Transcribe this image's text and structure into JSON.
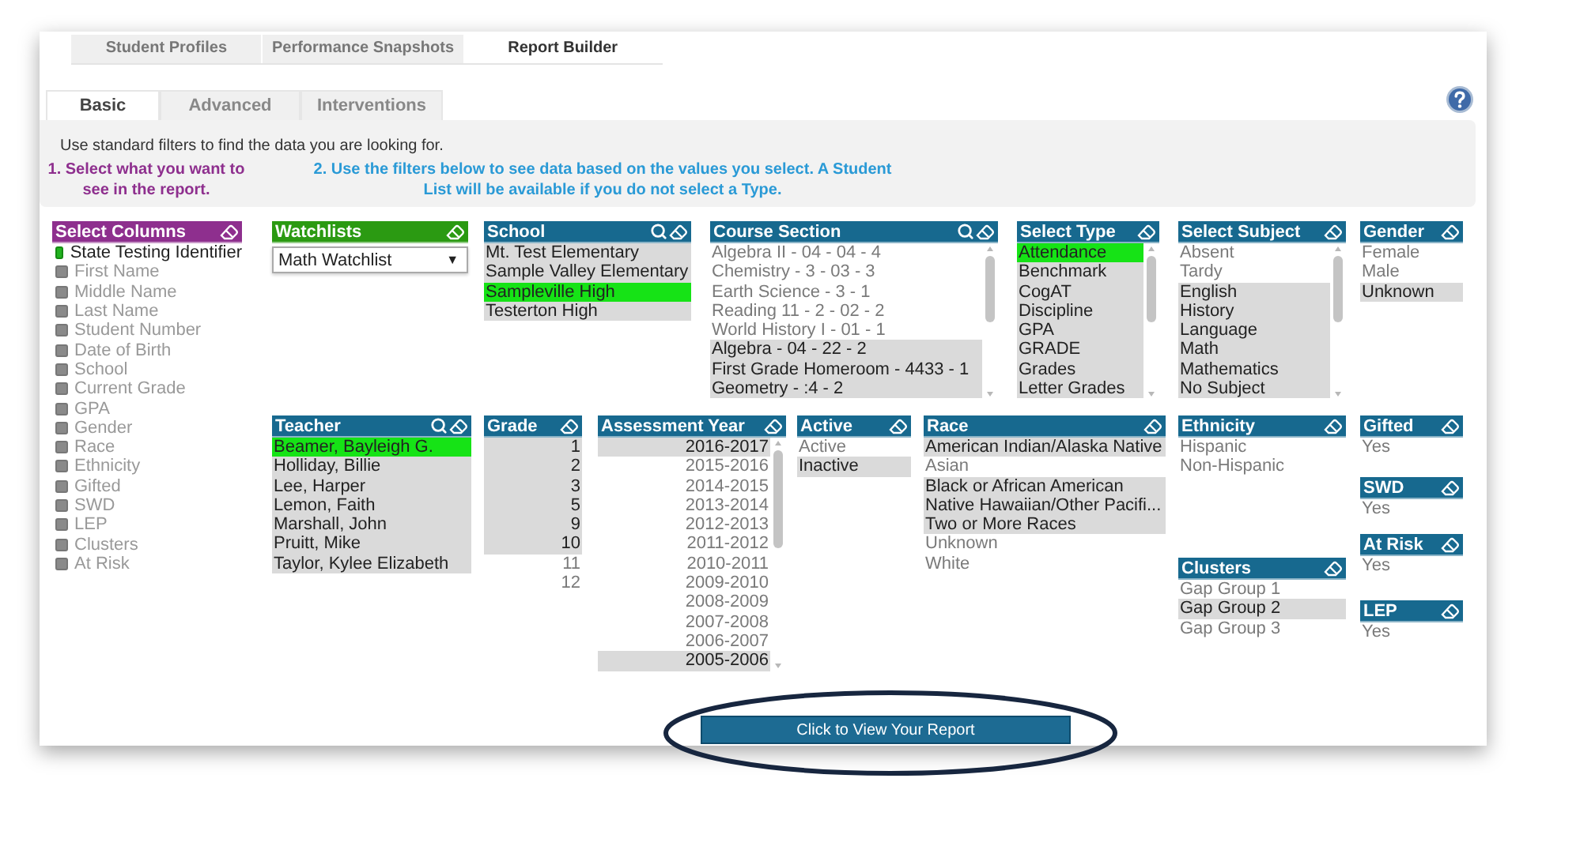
{
  "top_tabs": [
    {
      "label": "Student Profiles",
      "selected": false
    },
    {
      "label": "Performance Snapshots",
      "selected": false
    },
    {
      "label": "Report Builder",
      "selected": true
    }
  ],
  "sub_tabs": [
    {
      "label": "Basic",
      "selected": true
    },
    {
      "label": "Advanced",
      "selected": false
    },
    {
      "label": "Interventions",
      "selected": false
    }
  ],
  "intro": "Use standard filters to find the data you are looking for.",
  "steps": [
    {
      "text": "1. Select what you want to see in the report.",
      "color": "#8e2f8e"
    },
    {
      "text": "2. Use the filters below to see data based on the values you select. A Student List will be available if you do not select a Type.",
      "color": "#2a9ad6"
    }
  ],
  "columns_panel": {
    "title": "Select Columns",
    "color": "#8e2f8e",
    "items": [
      {
        "label": "State Testing Identifier",
        "checked": true
      },
      {
        "label": "First Name",
        "checked": false
      },
      {
        "label": "Middle Name",
        "checked": false
      },
      {
        "label": "Last Name",
        "checked": false
      },
      {
        "label": "Student Number",
        "checked": false
      },
      {
        "label": "Date of Birth",
        "checked": false
      },
      {
        "label": "School",
        "checked": false
      },
      {
        "label": "Current Grade",
        "checked": false
      },
      {
        "label": "GPA",
        "checked": false
      },
      {
        "label": "Gender",
        "checked": false
      },
      {
        "label": "Race",
        "checked": false
      },
      {
        "label": "Ethnicity",
        "checked": false
      },
      {
        "label": "Gifted",
        "checked": false
      },
      {
        "label": "SWD",
        "checked": false
      },
      {
        "label": "LEP",
        "checked": false
      },
      {
        "label": "Clusters",
        "checked": false
      },
      {
        "label": "At Risk",
        "checked": false
      }
    ]
  },
  "filter_rows": [
    [
      [
        {
          "kind": "watchlist",
          "title": "Watchlists",
          "color": "#2b9a12",
          "value": "Math Watchlist",
          "caret": "▼"
        }
      ],
      [
        {
          "kind": "list",
          "title": "School",
          "color": "#17698f",
          "searchable": true,
          "scrollable": false,
          "items": [
            {
              "label": "Mt. Test Elementary",
              "selected": false,
              "available": true
            },
            {
              "label": "Sample Valley Elementary",
              "selected": false,
              "available": true
            },
            {
              "label": "Sampleville High",
              "selected": true,
              "available": true
            },
            {
              "label": "Testerton High",
              "selected": false,
              "available": true
            }
          ]
        }
      ],
      [
        {
          "kind": "list",
          "title": "Course Section",
          "color": "#17698f",
          "searchable": true,
          "scrollable": true,
          "items": [
            {
              "label": "Algebra II - 04 - 04 - 4",
              "selected": false,
              "available": false
            },
            {
              "label": "Chemistry - 3 - 03 - 3",
              "selected": false,
              "available": false
            },
            {
              "label": "Earth Science - 3 - 1",
              "selected": false,
              "available": false
            },
            {
              "label": "Reading 11 - 2 - 02 - 2",
              "selected": false,
              "available": false
            },
            {
              "label": "World History I - 01 - 1",
              "selected": false,
              "available": false
            },
            {
              "label": "Algebra - 04 - 22 - 2",
              "selected": false,
              "available": true
            },
            {
              "label": "First Grade Homeroom - 4433 - 1",
              "selected": false,
              "available": true
            },
            {
              "label": "Geometry - :4 - 2",
              "selected": false,
              "available": true
            }
          ]
        }
      ],
      [
        {
          "kind": "list",
          "title": "Select Type",
          "color": "#17698f",
          "searchable": false,
          "scrollable": true,
          "items": [
            {
              "label": "Attendance",
              "selected": true,
              "available": true
            },
            {
              "label": "Benchmark",
              "selected": false,
              "available": true
            },
            {
              "label": "CogAT",
              "selected": false,
              "available": true
            },
            {
              "label": "Discipline",
              "selected": false,
              "available": true
            },
            {
              "label": "GPA",
              "selected": false,
              "available": true
            },
            {
              "label": "GRADE",
              "selected": false,
              "available": true
            },
            {
              "label": "Grades",
              "selected": false,
              "available": true
            },
            {
              "label": "Letter Grades",
              "selected": false,
              "available": true
            }
          ]
        }
      ],
      [
        {
          "kind": "list",
          "title": "Select Subject",
          "color": "#17698f",
          "searchable": false,
          "scrollable": true,
          "items": [
            {
              "label": "Absent",
              "selected": false,
              "available": false
            },
            {
              "label": "Tardy",
              "selected": false,
              "available": false
            },
            {
              "label": "English",
              "selected": false,
              "available": true
            },
            {
              "label": "History",
              "selected": false,
              "available": true
            },
            {
              "label": "Language",
              "selected": false,
              "available": true
            },
            {
              "label": "Math",
              "selected": false,
              "available": true
            },
            {
              "label": "Mathematics",
              "selected": false,
              "available": true
            },
            {
              "label": "No Subject",
              "selected": false,
              "available": true
            }
          ]
        }
      ],
      [
        {
          "kind": "list",
          "title": "Gender",
          "color": "#17698f",
          "searchable": false,
          "scrollable": false,
          "items": [
            {
              "label": "Female",
              "selected": false,
              "available": false
            },
            {
              "label": "Male",
              "selected": false,
              "available": false
            },
            {
              "label": "Unknown",
              "selected": false,
              "available": true
            }
          ]
        }
      ]
    ],
    [
      [
        {
          "kind": "list",
          "title": "Teacher",
          "color": "#17698f",
          "searchable": true,
          "scrollable": false,
          "items": [
            {
              "label": "Beamer, Bayleigh G.",
              "selected": true,
              "available": true
            },
            {
              "label": "Holliday, Billie",
              "selected": false,
              "available": true
            },
            {
              "label": "Lee, Harper",
              "selected": false,
              "available": true
            },
            {
              "label": "Lemon, Faith",
              "selected": false,
              "available": true
            },
            {
              "label": "Marshall, John",
              "selected": false,
              "available": true
            },
            {
              "label": "Pruitt, Mike",
              "selected": false,
              "available": true
            },
            {
              "label": "Taylor, Kylee Elizabeth",
              "selected": false,
              "available": true
            }
          ]
        }
      ],
      [
        {
          "kind": "numbers",
          "title": "Grade",
          "color": "#17698f",
          "searchable": false,
          "scrollable": false,
          "items": [
            {
              "label": "1",
              "selected": false,
              "available": true
            },
            {
              "label": "2",
              "selected": false,
              "available": true
            },
            {
              "label": "3",
              "selected": false,
              "available": true
            },
            {
              "label": "5",
              "selected": false,
              "available": true
            },
            {
              "label": "9",
              "selected": false,
              "available": true
            },
            {
              "label": "10",
              "selected": false,
              "available": true
            },
            {
              "label": "11",
              "selected": false,
              "available": false
            },
            {
              "label": "12",
              "selected": false,
              "available": false
            }
          ]
        }
      ],
      [
        {
          "kind": "numbers",
          "title": "Assessment Year",
          "color": "#17698f",
          "searchable": false,
          "scrollable": true,
          "items": [
            {
              "label": "2016-2017",
              "selected": false,
              "available": true
            },
            {
              "label": "2015-2016",
              "selected": false,
              "available": false
            },
            {
              "label": "2014-2015",
              "selected": false,
              "available": false
            },
            {
              "label": "2013-2014",
              "selected": false,
              "available": false
            },
            {
              "label": "2012-2013",
              "selected": false,
              "available": false
            },
            {
              "label": "2011-2012",
              "selected": false,
              "available": false
            },
            {
              "label": "2010-2011",
              "selected": false,
              "available": false
            },
            {
              "label": "2009-2010",
              "selected": false,
              "available": false
            },
            {
              "label": "2008-2009",
              "selected": false,
              "available": false
            },
            {
              "label": "2007-2008",
              "selected": false,
              "available": false
            },
            {
              "label": "2006-2007",
              "selected": false,
              "available": false
            },
            {
              "label": "2005-2006",
              "selected": false,
              "available": true
            }
          ]
        }
      ],
      [
        {
          "kind": "list",
          "title": "Active",
          "color": "#17698f",
          "searchable": false,
          "scrollable": false,
          "items": [
            {
              "label": "Active",
              "selected": false,
              "available": false
            },
            {
              "label": "Inactive",
              "selected": false,
              "available": true
            }
          ]
        }
      ],
      [
        {
          "kind": "list",
          "title": "Race",
          "color": "#17698f",
          "searchable": false,
          "scrollable": false,
          "items": [
            {
              "label": "American Indian/Alaska Native",
              "selected": false,
              "available": true
            },
            {
              "label": "Asian",
              "selected": false,
              "available": false
            },
            {
              "label": "Black or African American",
              "selected": false,
              "available": true
            },
            {
              "label": "Native Hawaiian/Other Pacifi...",
              "selected": false,
              "available": true
            },
            {
              "label": "Two or More Races",
              "selected": false,
              "available": true
            },
            {
              "label": "Unknown",
              "selected": false,
              "available": false
            },
            {
              "label": "White",
              "selected": false,
              "available": false
            }
          ]
        }
      ],
      [
        {
          "kind": "list",
          "title": "Ethnicity",
          "color": "#17698f",
          "searchable": false,
          "scrollable": false,
          "items": [
            {
              "label": "Hispanic",
              "selected": false,
              "available": false
            },
            {
              "label": "Non-Hispanic",
              "selected": false,
              "available": false
            }
          ]
        },
        {
          "kind": "list",
          "title": "Clusters",
          "color": "#17698f",
          "searchable": false,
          "scrollable": false,
          "items": [
            {
              "label": "Gap Group 1",
              "selected": false,
              "available": false
            },
            {
              "label": "Gap Group 2",
              "selected": false,
              "available": true
            },
            {
              "label": "Gap Group 3",
              "selected": false,
              "available": false
            }
          ]
        }
      ],
      [
        {
          "kind": "list",
          "title": "Gifted",
          "color": "#17698f",
          "searchable": false,
          "scrollable": false,
          "items": [
            {
              "label": "Yes",
              "selected": false,
              "available": false
            }
          ]
        },
        {
          "kind": "list",
          "title": "SWD",
          "color": "#17698f",
          "searchable": false,
          "scrollable": false,
          "items": [
            {
              "label": "Yes",
              "selected": false,
              "available": false
            }
          ]
        },
        {
          "kind": "list",
          "title": "At Risk",
          "color": "#17698f",
          "searchable": false,
          "scrollable": false,
          "items": [
            {
              "label": "Yes",
              "selected": false,
              "available": false
            }
          ]
        },
        {
          "kind": "list",
          "title": "LEP",
          "color": "#17698f",
          "searchable": false,
          "scrollable": false,
          "items": [
            {
              "label": "Yes",
              "selected": false,
              "available": false
            }
          ]
        }
      ]
    ]
  ],
  "report_button": "Click to View Your Report"
}
